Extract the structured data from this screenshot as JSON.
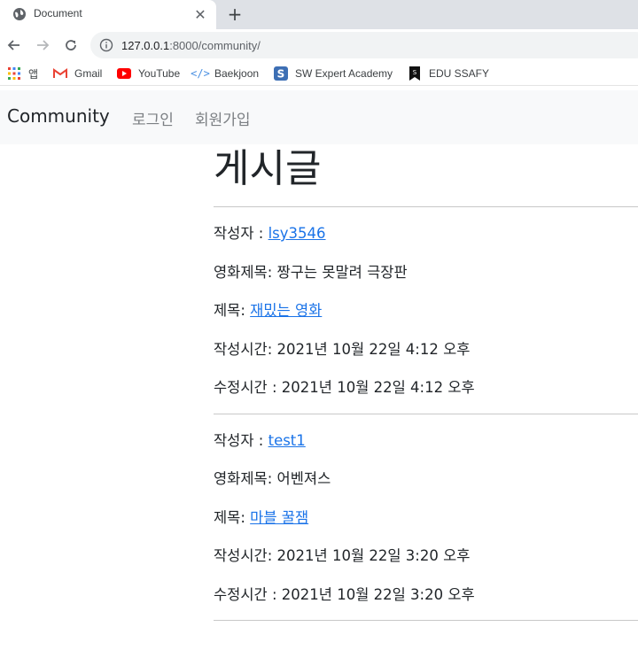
{
  "browser": {
    "tab_title": "Document",
    "url_host": "127.0.0.1",
    "url_rest": ":8000/community/",
    "bookmarks": [
      {
        "label": "앱",
        "icon": "apps-grid-icon"
      },
      {
        "label": "Gmail",
        "icon": "gmail-icon"
      },
      {
        "label": "YouTube",
        "icon": "youtube-icon"
      },
      {
        "label": "Baekjoon",
        "icon": "code-icon"
      },
      {
        "label": "SW Expert Academy",
        "icon": "swea-icon"
      },
      {
        "label": "EDU SSAFY",
        "icon": "ssafy-icon"
      }
    ]
  },
  "navbar": {
    "brand": "Community",
    "login": "로그인",
    "signup": "회원가입"
  },
  "page": {
    "title": "게시글"
  },
  "posts": [
    {
      "author_label": "작성자 : ",
      "author": "lsy3546",
      "movie_label": "영화제목: ",
      "movie": "짱구는 못말려 극장판",
      "title_label": "제목: ",
      "title": "재밌는 영화",
      "created_label": "작성시간: ",
      "created": "2021년 10월 22일 4:12 오후",
      "updated_label": "수정시간 : ",
      "updated": "2021년 10월 22일 4:12 오후"
    },
    {
      "author_label": "작성자 : ",
      "author": "test1",
      "movie_label": "영화제목: ",
      "movie": "어벤져스",
      "title_label": "제목: ",
      "title": "마블 꿀잼",
      "created_label": "작성시간: ",
      "created": "2021년 10월 22일 3:20 오후",
      "updated_label": "수정시간 : ",
      "updated": "2021년 10월 22일 3:20 오후"
    }
  ]
}
